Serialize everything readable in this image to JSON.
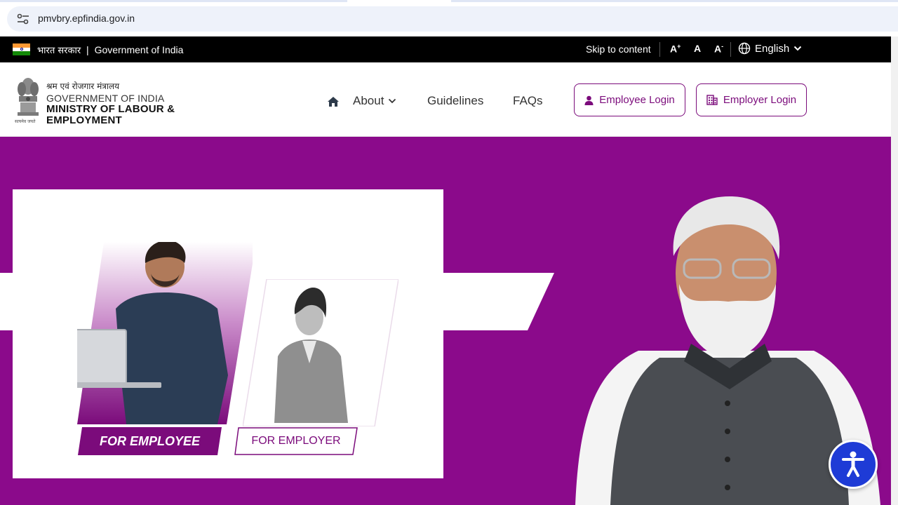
{
  "browser": {
    "url": "pmvbry.epfindia.gov.in"
  },
  "gov_strip": {
    "hindi_label": "भारत सरकार",
    "separator": "|",
    "english_label": "Government of India",
    "skip_link": "Skip to content",
    "font_increase": "A",
    "font_increase_sup": "+",
    "font_normal": "A",
    "font_decrease": "A",
    "font_decrease_sup": "-",
    "language": "English"
  },
  "header": {
    "ministry_hindi": "श्रम एवं रोजगार मंत्रालय",
    "government": "GOVERNMENT OF INDIA",
    "ministry_line1": "MINISTRY OF LABOUR &",
    "ministry_line2": "EMPLOYMENT",
    "emblem_motto": "सत्यमेव जयते",
    "nav": {
      "about": "About",
      "guidelines": "Guidelines",
      "faqs": "FAQs"
    },
    "employee_login": "Employee Login",
    "employer_login": "Employer Login"
  },
  "hero": {
    "for_employee": "FOR EMPLOYEE",
    "for_employer": "FOR EMPLOYER"
  },
  "colors": {
    "brand_purple": "#8b0a8b",
    "button_purple": "#7b0b7b",
    "accessibility_blue": "#1e3bd6"
  },
  "icons": [
    "site-info-icon",
    "home-icon",
    "chevron-down-icon",
    "globe-icon",
    "user-icon",
    "building-icon",
    "accessibility-icon"
  ]
}
